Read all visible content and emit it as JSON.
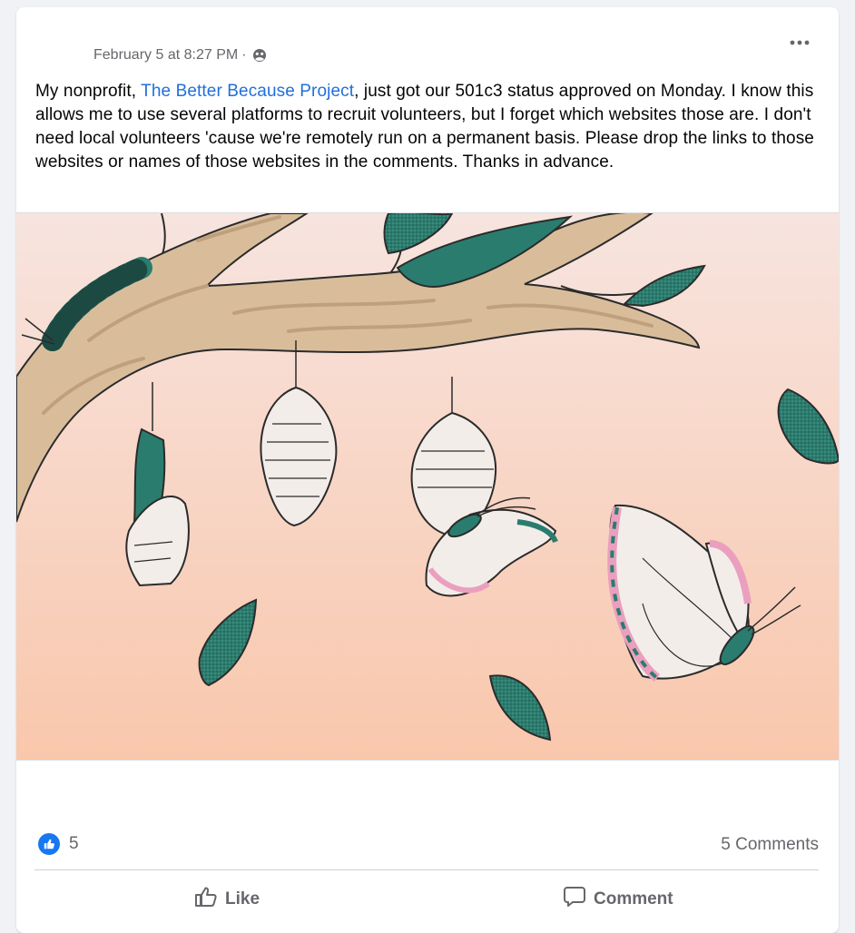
{
  "post": {
    "timestamp": "February 5 at 8:27 PM",
    "separator": "·",
    "audience_icon": "globe-icon",
    "more_icon": "more-options-icon",
    "text_before_link": "My nonprofit, ",
    "link_text": "The Better Because Project",
    "text_after_link": ", just got our 501c3 status approved on Monday. I know this allows me to use several platforms to recruit volunteers, but I forget which websites those are. I don't need local volunteers 'cause we're remotely run on a permanent basis. Please drop the links to those websites or names of those websites in the comments. Thanks in advance.",
    "image_alt": "Illustration of caterpillar, cocoons and butterflies on a branch"
  },
  "footer": {
    "like_count": "5",
    "comments_count": "5 Comments",
    "like_label": "Like",
    "comment_label": "Comment"
  },
  "colors": {
    "link": "#216fdb",
    "teal": "#2a7d6e",
    "branch": "#d9bd9b",
    "sky_top": "#f7e4df",
    "sky_bottom": "#f9c7ac",
    "pink": "#eb9fbe",
    "like_blue": "#1877f2"
  }
}
